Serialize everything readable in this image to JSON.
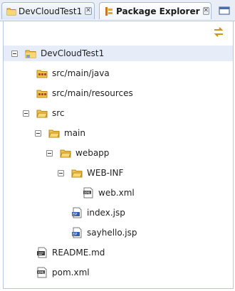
{
  "tabs": [
    {
      "label": "DevCloudTest1",
      "icon": "folder-icon"
    },
    {
      "label": "Package Explorer",
      "icon": "package-explorer-icon"
    }
  ],
  "toolbar": {
    "link_with_editor_icon": "link-with-editor-icon"
  },
  "tree": {
    "project": "DevCloudTest1",
    "src_main_java": "src/main/java",
    "src_main_resources": "src/main/resources",
    "src": "src",
    "main": "main",
    "webapp": "webapp",
    "webinf": "WEB-INF",
    "web_xml": "web.xml",
    "index_jsp": "index.jsp",
    "sayhello_jsp": "sayhello.jsp",
    "readme": "README.md",
    "pom": "pom.xml"
  },
  "colors": {
    "selection": "#e6edf8",
    "folder": "#f0c24a",
    "accent": "#d48a1a"
  }
}
